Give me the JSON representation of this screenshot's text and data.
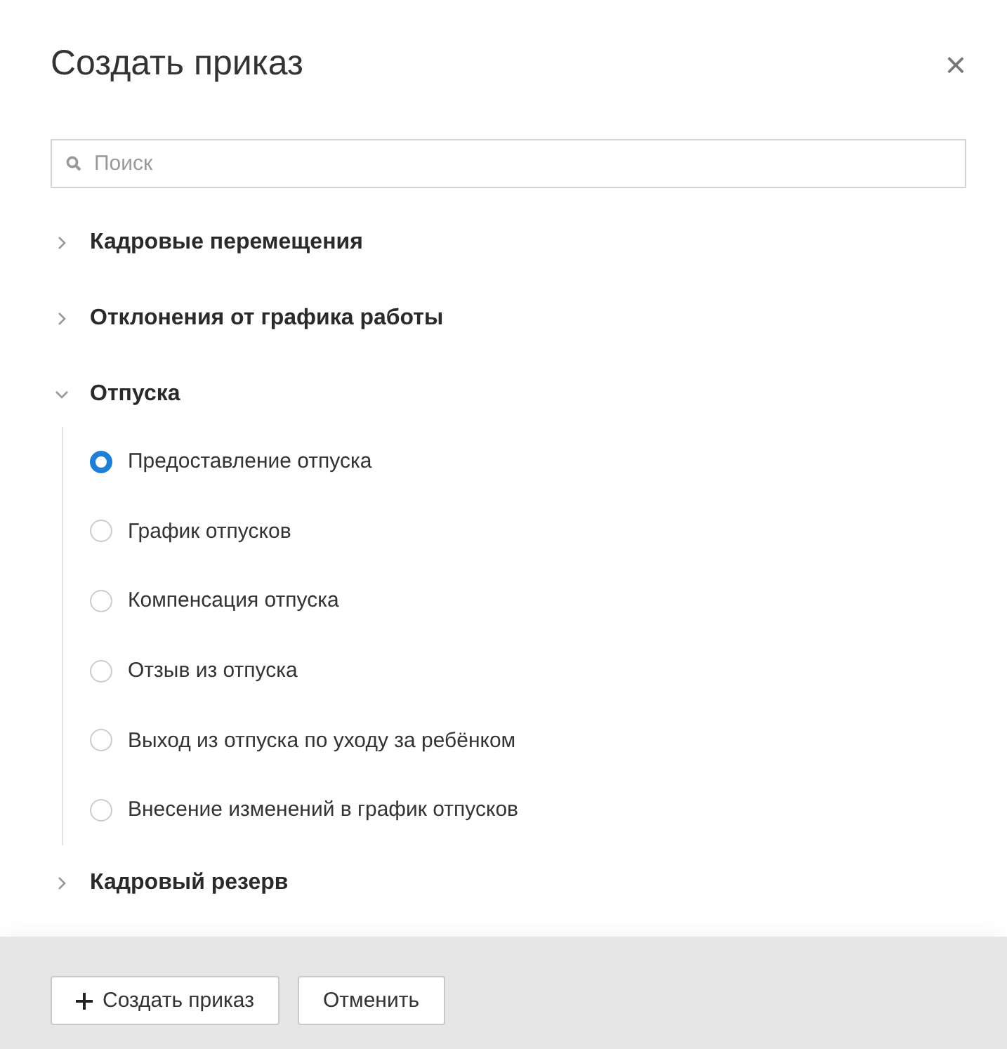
{
  "dialog": {
    "title": "Создать приказ",
    "close": "×"
  },
  "search": {
    "placeholder": "Поиск"
  },
  "groups": [
    {
      "label": "Кадровые перемещения",
      "expanded": false
    },
    {
      "label": "Отклонения от графика работы",
      "expanded": false
    },
    {
      "label": "Отпуска",
      "expanded": true,
      "children": [
        {
          "label": "Предоставление отпуска",
          "selected": true
        },
        {
          "label": "График отпусков",
          "selected": false
        },
        {
          "label": "Компенсация отпуска",
          "selected": false
        },
        {
          "label": "Отзыв из отпуска",
          "selected": false
        },
        {
          "label": "Выход из отпуска по уходу за ребёнком",
          "selected": false
        },
        {
          "label": "Внесение изменений в график отпусков",
          "selected": false
        }
      ]
    },
    {
      "label": "Кадровый резерв",
      "expanded": false
    }
  ],
  "buttons": [
    {
      "kind": "primary",
      "label": "Создать приказ"
    },
    {
      "kind": "secondary",
      "label": "Отменить"
    }
  ]
}
